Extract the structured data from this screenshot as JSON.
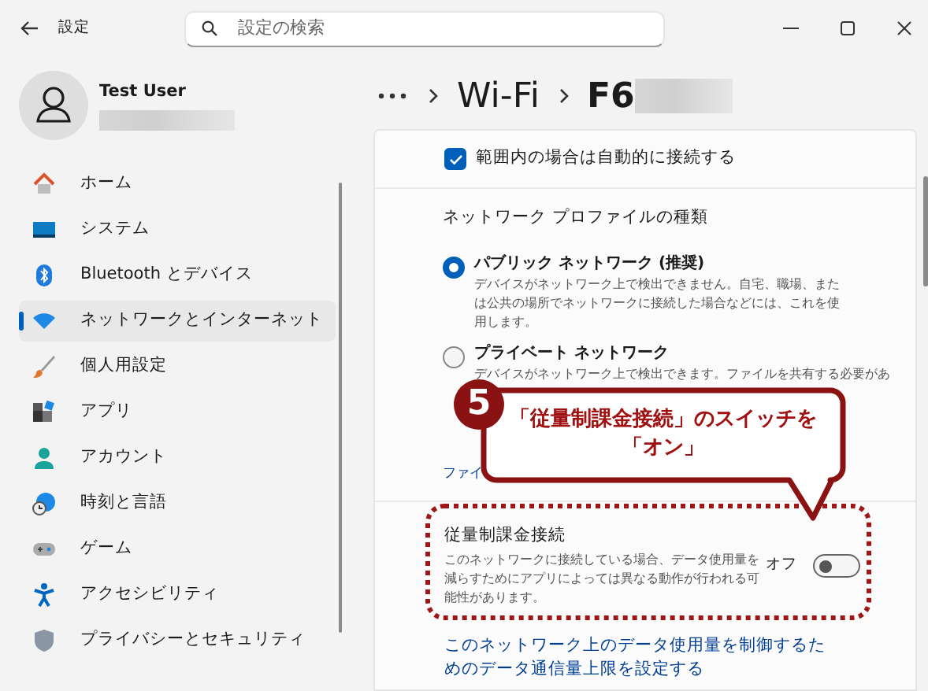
{
  "window": {
    "title": "設定"
  },
  "search": {
    "placeholder": "設定の検索"
  },
  "user": {
    "name": "Test User"
  },
  "sidebar": {
    "items": [
      {
        "label": "ホーム",
        "selected": false
      },
      {
        "label": "システム",
        "selected": false
      },
      {
        "label": "Bluetooth とデバイス",
        "selected": false
      },
      {
        "label": "ネットワークとインターネット",
        "selected": true
      },
      {
        "label": "個人用設定",
        "selected": false
      },
      {
        "label": "アプリ",
        "selected": false
      },
      {
        "label": "アカウント",
        "selected": false
      },
      {
        "label": "時刻と言語",
        "selected": false
      },
      {
        "label": "ゲーム",
        "selected": false
      },
      {
        "label": "アクセシビリティ",
        "selected": false
      },
      {
        "label": "プライバシーとセキュリティ",
        "selected": false
      }
    ]
  },
  "breadcrumb": [
    "Wi-Fi",
    "F6"
  ],
  "content": {
    "auto_connect": {
      "label": "範囲内の場合は自動的に接続する",
      "checked": true
    },
    "profile_heading": "ネットワーク プロファイルの種類",
    "profiles": [
      {
        "label": "パブリック ネットワーク (推奨)",
        "description": "デバイスがネットワーク上で検出できません。自宅、職場、または公共の場所でネットワークに接続した場合などには、これを使用します。",
        "selected": true
      },
      {
        "label": "プライベート ネットワーク",
        "description": "デバイスがネットワーク上で検出できます。ファイルを共有する必要があ",
        "selected": false
      }
    ],
    "firewall_link": "ファイ",
    "metered": {
      "title": "従量制課金接続",
      "description": "このネットワークに接続している場合、データ使用量を減らすためにアプリによっては異なる動作が行われる可能性があります。",
      "state_label": "オフ",
      "on": false
    },
    "data_limit_link": "このネットワーク上のデータ使用量を制御するためのデータ通信量上限を設定する"
  },
  "annotation": {
    "step": "5",
    "lines": [
      "「従量制課金接続」のスイッチを",
      "「オン」"
    ]
  }
}
